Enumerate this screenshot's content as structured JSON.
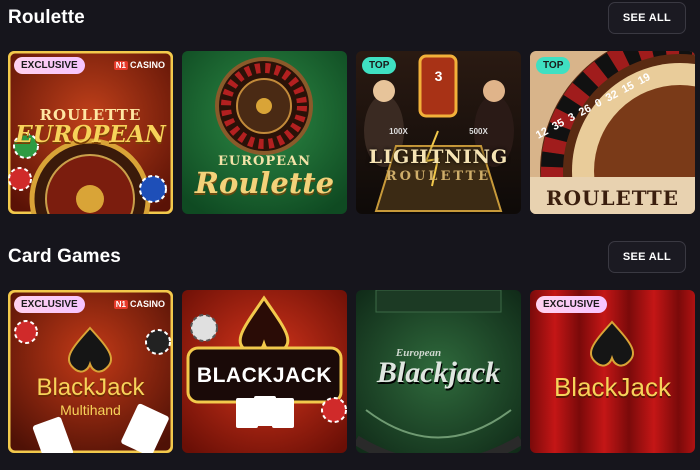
{
  "sections": [
    {
      "title": "Roulette",
      "see_all": "SEE ALL",
      "games": [
        {
          "badge": "EXCLUSIVE",
          "provider": "CASINO",
          "line1": "ROULETTE",
          "line2": "EUROPEAN"
        },
        {
          "line1": "EUROPEAN",
          "line2": "Roulette"
        },
        {
          "badge": "TOP",
          "line1": "LIGHTNING",
          "line2": "ROULETTE",
          "multiplier1": "100X",
          "multiplier2": "500X",
          "number": "3"
        },
        {
          "badge": "TOP",
          "line1": "ROULETTE",
          "numbers": [
            "12",
            "35",
            "3",
            "26",
            "0",
            "32",
            "15",
            "19"
          ]
        }
      ]
    },
    {
      "title": "Card Games",
      "see_all": "SEE ALL",
      "games": [
        {
          "badge": "EXCLUSIVE",
          "provider": "CASINO",
          "line1": "BlackJack",
          "line2": "Multihand"
        },
        {
          "line1": "BLACKJACK"
        },
        {
          "line1": "European",
          "line2": "Blackjack"
        },
        {
          "badge": "EXCLUSIVE",
          "line1": "BlackJack"
        }
      ]
    }
  ],
  "colors": {
    "background": "#16151c",
    "badge_top": "#3fe0c2",
    "badge_exclusive": "#f6c4ff",
    "gold": "#f2c94c"
  }
}
